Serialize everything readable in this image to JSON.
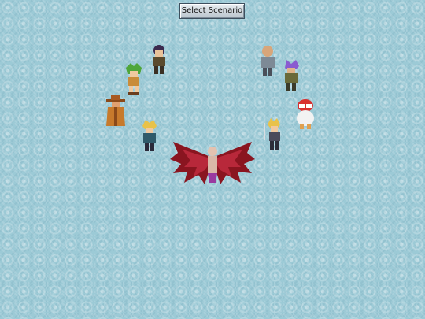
{
  "menu": {
    "select_scenario_label": "Select Scenario"
  },
  "characters": [
    {
      "id": "dark-haired-fighter",
      "icon": "sprite-purple-hair"
    },
    {
      "id": "green-haired-girl",
      "icon": "sprite-green-hair"
    },
    {
      "id": "cowboy-hat-figure",
      "icon": "sprite-orange-hat"
    },
    {
      "id": "blonde-youth",
      "icon": "sprite-blonde-hair"
    },
    {
      "id": "bald-monk",
      "icon": "sprite-bald"
    },
    {
      "id": "purple-haired-warrior",
      "icon": "sprite-purple-spiky"
    },
    {
      "id": "round-robot",
      "icon": "sprite-red-robot"
    },
    {
      "id": "blonde-swordsman",
      "icon": "sprite-blonde-sword"
    }
  ],
  "boss": {
    "id": "winged-demon",
    "icon": "sprite-red-wings"
  },
  "colors": {
    "background": "#9ccad6",
    "button_border": "#3d4f5e"
  }
}
